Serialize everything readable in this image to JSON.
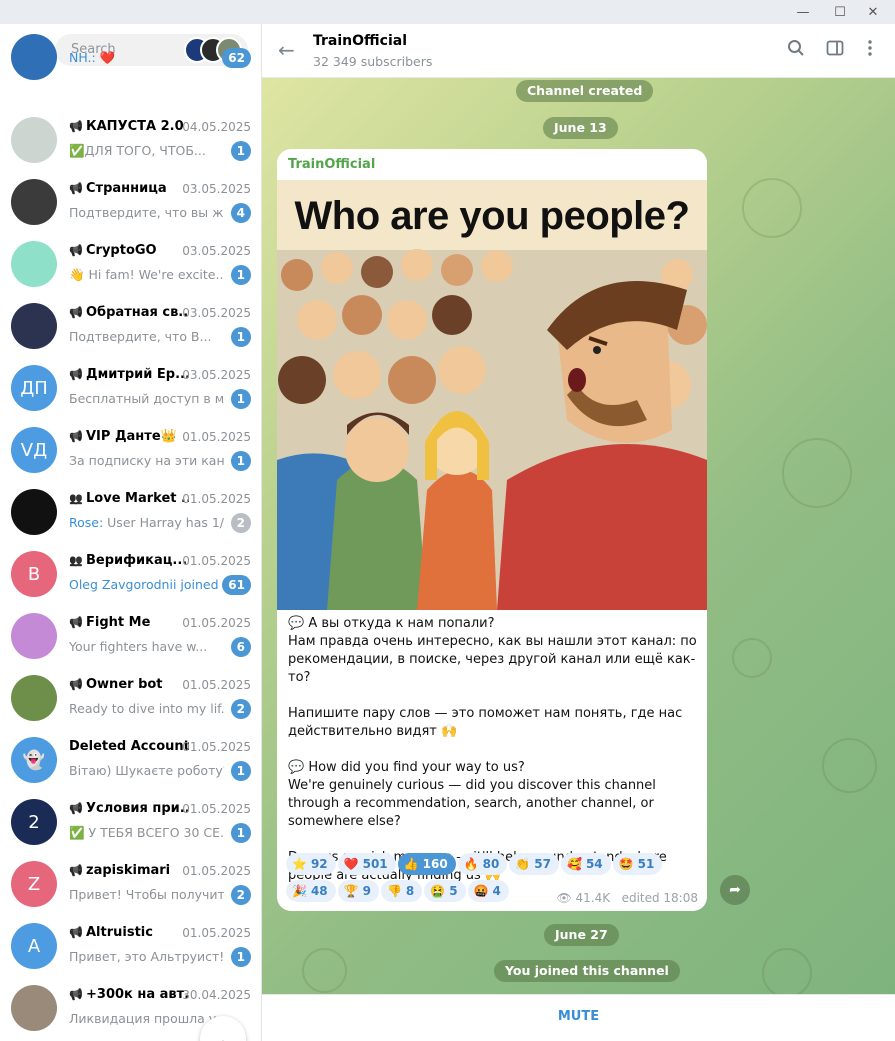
{
  "window": {
    "minimize_icon": "minimize-icon",
    "maximize_icon": "maximize-icon",
    "close_icon": "close-icon"
  },
  "search": {
    "placeholder": "Search"
  },
  "chats": [
    {
      "title": "",
      "date": "",
      "message": "NH.: ❤️",
      "badge": "62",
      "avatar_color": "#2f6fb5",
      "avatar_text": ""
    },
    {
      "title": "КАПУСТА 2.0 ...",
      "date": "04.05.2025",
      "message": "✅ДЛЯ ТОГО, ЧТОБ...",
      "badge": "1",
      "avatar_color": "#cdd5d0",
      "avatar_text": ""
    },
    {
      "title": "Странница",
      "date": "03.05.2025",
      "message": "Подтвердите, что вы жи...",
      "badge": "4",
      "avatar_color": "#3b3b3b",
      "avatar_text": ""
    },
    {
      "title": "CryptoGO",
      "date": "03.05.2025",
      "message": "👋 Hi fam!  We're excite...",
      "badge": "1",
      "avatar_color": "#8ee0c8",
      "avatar_text": ""
    },
    {
      "title": "Обратная св...",
      "date": "03.05.2025",
      "message": "Подтвердите, что В...",
      "badge": "1",
      "avatar_color": "#2b3350",
      "avatar_text": ""
    },
    {
      "title": "Дмитрий Ер...",
      "date": "03.05.2025",
      "message": "Бесплатный доступ в м...",
      "badge": "1",
      "avatar_color": "#4d9be0",
      "avatar_text": "ДП"
    },
    {
      "title": "VIP Данте👑",
      "date": "01.05.2025",
      "message": "За подписку на эти кана...",
      "badge": "1",
      "avatar_color": "#4d9be0",
      "avatar_text": "VД"
    },
    {
      "title": "Love Market ...",
      "date": "01.05.2025",
      "message_sender": "Rose:",
      "message": " User Harray has 1/...",
      "badge": "2",
      "avatar_color": "#111111",
      "avatar_text": ""
    },
    {
      "title": "Верификац...",
      "date": "01.05.2025",
      "message_sender": "Oleg Zavgorodnii joined ...",
      "message": "",
      "badge": "61",
      "avatar_color": "#e6677c",
      "avatar_text": "В"
    },
    {
      "title": "Fight Me",
      "date": "01.05.2025",
      "message": "Your fighters have w...",
      "badge": "6",
      "avatar_color": "#c48ad6",
      "avatar_text": ""
    },
    {
      "title": "Owner bot",
      "date": "01.05.2025",
      "message": "Ready to dive into my lif...",
      "badge": "2",
      "avatar_color": "#6d8f4a",
      "avatar_text": ""
    },
    {
      "title": "Deleted Account",
      "date": "01.05.2025",
      "message": "Вітаю) Шукаєте роботу?...",
      "badge": "1",
      "avatar_color": "#4d9be0",
      "avatar_text": "👻"
    },
    {
      "title": "Условия при...",
      "date": "01.05.2025",
      "message": "✅ У ТЕБЯ ВСЕГО 30 СЕ...",
      "badge": "1",
      "avatar_color": "#1a2b55",
      "avatar_text": "2"
    },
    {
      "title": "zapiskimari",
      "date": "01.05.2025",
      "message": "Привет! Чтобы получит...",
      "badge": "2",
      "avatar_color": "#e6677c",
      "avatar_text": "Z"
    },
    {
      "title": "Altruistic",
      "date": "01.05.2025",
      "message": "Привет, это Альтруист! ...",
      "badge": "1",
      "avatar_color": "#4d9be0",
      "avatar_text": "A"
    },
    {
      "title": "+300к на авт...",
      "date": "30.04.2025",
      "message": "Ликвидация прошла у...",
      "badge": "",
      "avatar_color": "#9a8a7a",
      "avatar_text": ""
    }
  ],
  "channel": {
    "title": "TrainOfficial",
    "subscribers": "32 349 subscribers"
  },
  "service": {
    "created": "Channel created",
    "date1": "June 13",
    "date2": "June 27",
    "joined": "You joined this channel"
  },
  "post": {
    "author": "TrainOfficial",
    "image_title": "Who are you people?",
    "lines": [
      "💬 А вы откуда к нам попали?",
      "Нам правда очень интересно, как вы нашли этот канал: по рекомендации, в поиске, через другой канал или ещё как-то?",
      "",
      "Напишите пару слов — это поможет нам понять, где нас действительно видят 🙌",
      "",
      "💬 How did you find your way to us?",
      "We're genuinely curious — did you discover this channel through a recommendation, search, another channel, or somewhere else?",
      "",
      "Drop us a quick message — it'll help us understand where people are actually finding us 🙌"
    ],
    "reactions": [
      {
        "emoji": "⭐",
        "count": "92"
      },
      {
        "emoji": "❤️",
        "count": "501"
      },
      {
        "emoji": "👍",
        "count": "160",
        "active": true
      },
      {
        "emoji": "🔥",
        "count": "80"
      },
      {
        "emoji": "👏",
        "count": "57"
      },
      {
        "emoji": "🥰",
        "count": "54"
      },
      {
        "emoji": "🤩",
        "count": "51"
      },
      {
        "emoji": "🎉",
        "count": "48"
      },
      {
        "emoji": "🏆",
        "count": "9"
      },
      {
        "emoji": "👎",
        "count": "8"
      },
      {
        "emoji": "🤮",
        "count": "5"
      },
      {
        "emoji": "🤬",
        "count": "4"
      }
    ],
    "views": "41.4K",
    "edited": "edited 18:08"
  },
  "bottom": {
    "mute": "MUTE"
  }
}
